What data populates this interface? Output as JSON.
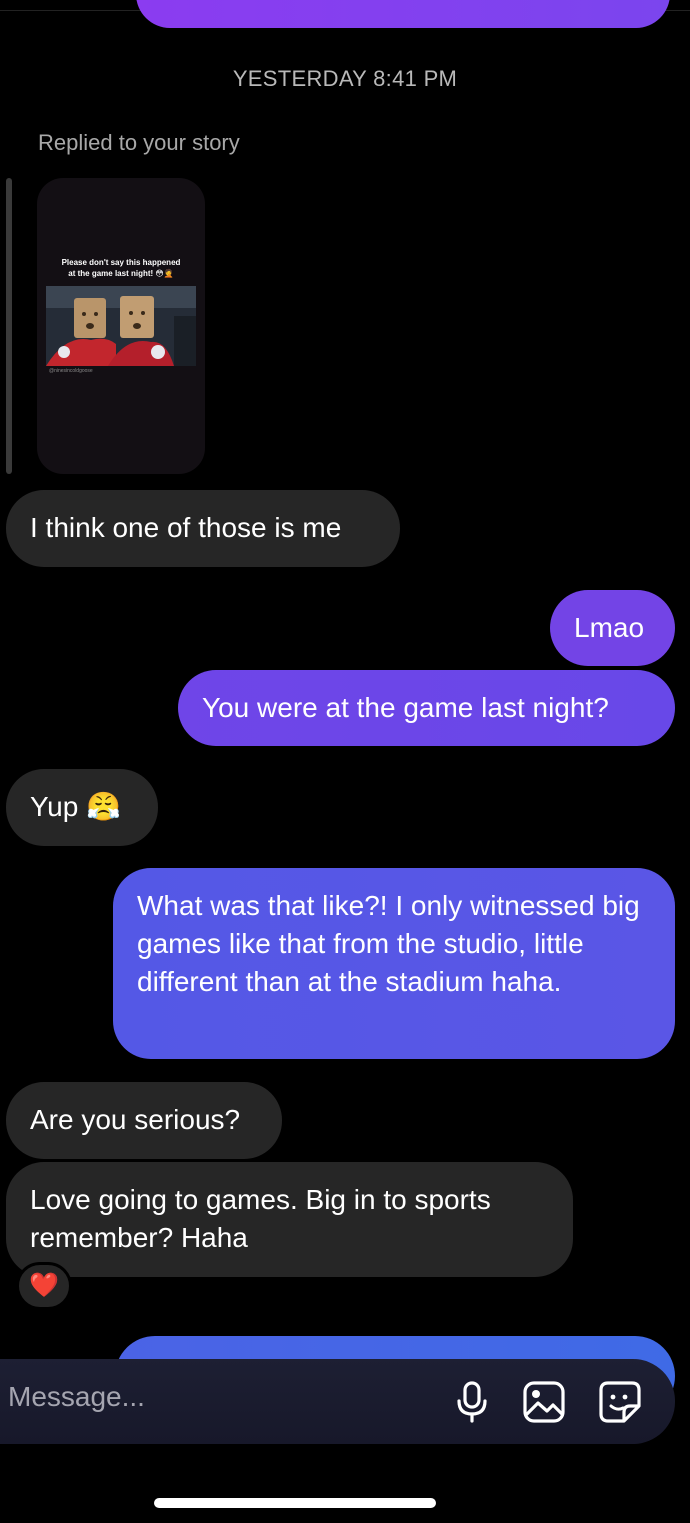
{
  "thread": {
    "timestamp": "YESTERDAY 8:41 PM",
    "replied_label": "Replied to your story",
    "story": {
      "caption_line1": "Please don't say this happened",
      "caption_line2": "at the game last night! 😳🤦",
      "credit": "@ninesincoldgoose"
    },
    "messages": [
      {
        "side": "incoming",
        "text": "I think one of those is me"
      },
      {
        "side": "outgoing",
        "text": "Lmao"
      },
      {
        "side": "outgoing",
        "text": "You were at the game last night?"
      },
      {
        "side": "incoming",
        "text": "Yup 😤"
      },
      {
        "side": "outgoing",
        "text": "What was that like?! I only witnessed big games like that from the studio, little different than at the stadium haha."
      },
      {
        "side": "incoming",
        "text": "Are you serious?"
      },
      {
        "side": "incoming",
        "text": "Love going to games. Big in to sports remember? Haha"
      }
    ],
    "reaction": "❤️"
  },
  "composer": {
    "placeholder": "Message...",
    "icons": [
      "microphone-icon",
      "gallery-icon",
      "sticker-icon"
    ]
  },
  "colors": {
    "background": "#000000",
    "incoming_bubble": "#262626",
    "outgoing_purple": "#7a43ec",
    "outgoing_blue": "#4f5ee4"
  }
}
